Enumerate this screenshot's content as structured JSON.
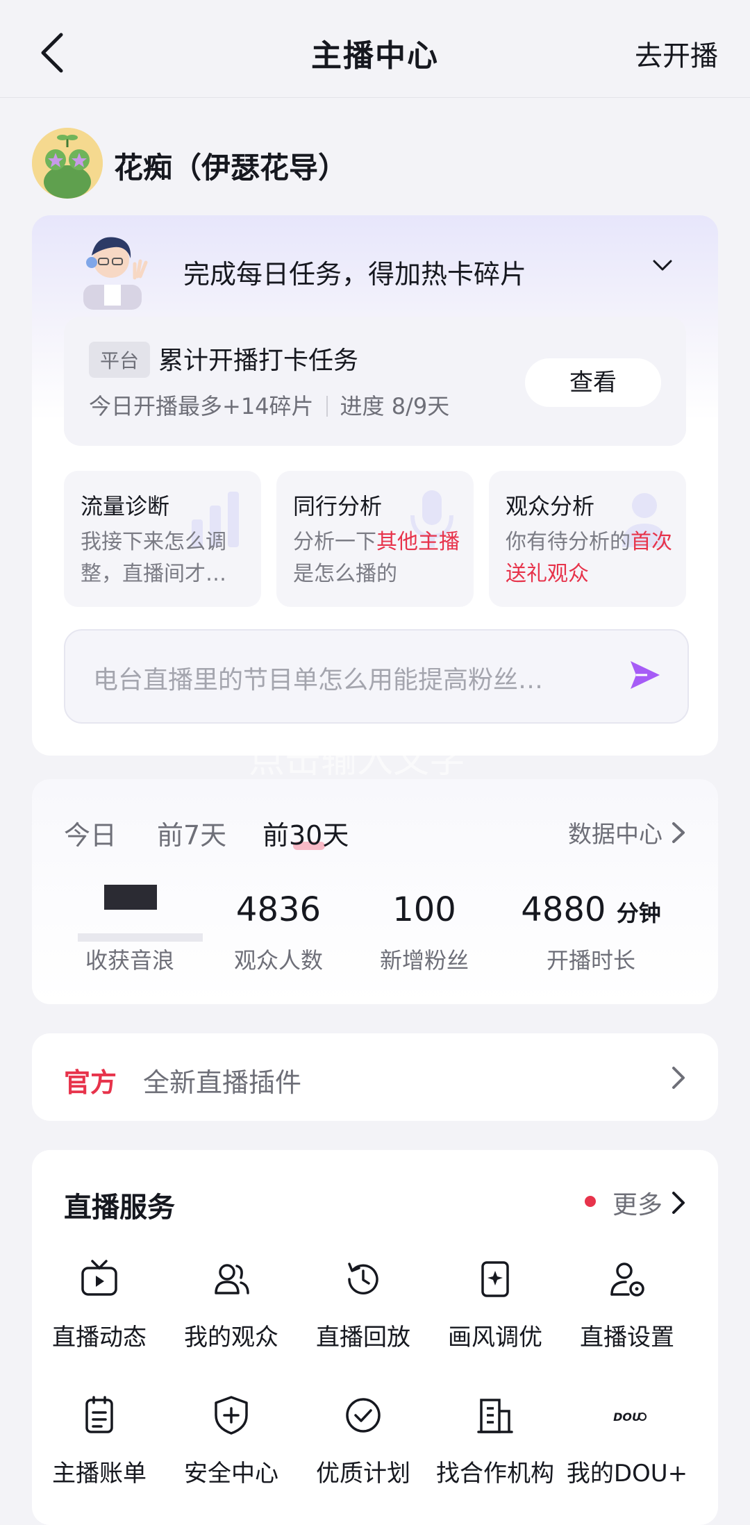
{
  "header": {
    "title": "主播中心",
    "go_live": "去开播"
  },
  "user": {
    "name": "花痴（伊瑟花导）"
  },
  "daily_task": {
    "headline": "完成每日任务，得加热卡碎片",
    "checkin": {
      "tag": "平台",
      "title": "累计开播打卡任务",
      "reward": "今日开播最多+14碎片",
      "progress": "进度 8/9天",
      "button": "查看"
    },
    "analysis": [
      {
        "title": "流量诊断",
        "desc_pre": "我接下来怎么调整，直播间才…",
        "desc_hl": "",
        "desc_post": ""
      },
      {
        "title": "同行分析",
        "desc_pre": "分析一下",
        "desc_hl": "其他主播",
        "desc_post": "是怎么播的"
      },
      {
        "title": "观众分析",
        "desc_pre": "你有待分析的",
        "desc_hl": "首次送礼观众",
        "desc_post": ""
      }
    ],
    "ask_placeholder": "电台直播里的节目单怎么用能提高粉丝…"
  },
  "watermark": "点击输入文字",
  "stats": {
    "tabs": [
      "今日",
      "前7天",
      "前30天"
    ],
    "active_tab": "前30天",
    "data_center": "数据中心",
    "items": [
      {
        "label": "收获音浪",
        "value": ""
      },
      {
        "label": "观众人数",
        "value": "4836"
      },
      {
        "label": "新增粉丝",
        "value": "100"
      },
      {
        "label": "开播时长",
        "value": "4880",
        "unit": "分钟"
      }
    ]
  },
  "official": {
    "tag": "官方",
    "text": "全新直播插件"
  },
  "services": {
    "title": "直播服务",
    "more": "更多",
    "items": [
      {
        "label": "直播动态",
        "icon": "tv-play-icon"
      },
      {
        "label": "我的观众",
        "icon": "audience-icon"
      },
      {
        "label": "直播回放",
        "icon": "replay-clock-icon"
      },
      {
        "label": "画风调优",
        "icon": "style-tune-icon"
      },
      {
        "label": "直播设置",
        "icon": "user-settings-icon"
      },
      {
        "label": "主播账单",
        "icon": "bill-icon"
      },
      {
        "label": "安全中心",
        "icon": "shield-plus-icon"
      },
      {
        "label": "优质计划",
        "icon": "check-circle-icon"
      },
      {
        "label": "找合作机构",
        "icon": "building-icon"
      },
      {
        "label": "我的DOU+",
        "icon": "dou-plus-icon"
      }
    ]
  },
  "colors": {
    "accent_red": "#e7334b",
    "send_purple": "#a65cf6",
    "background": "#f3f3f7"
  }
}
